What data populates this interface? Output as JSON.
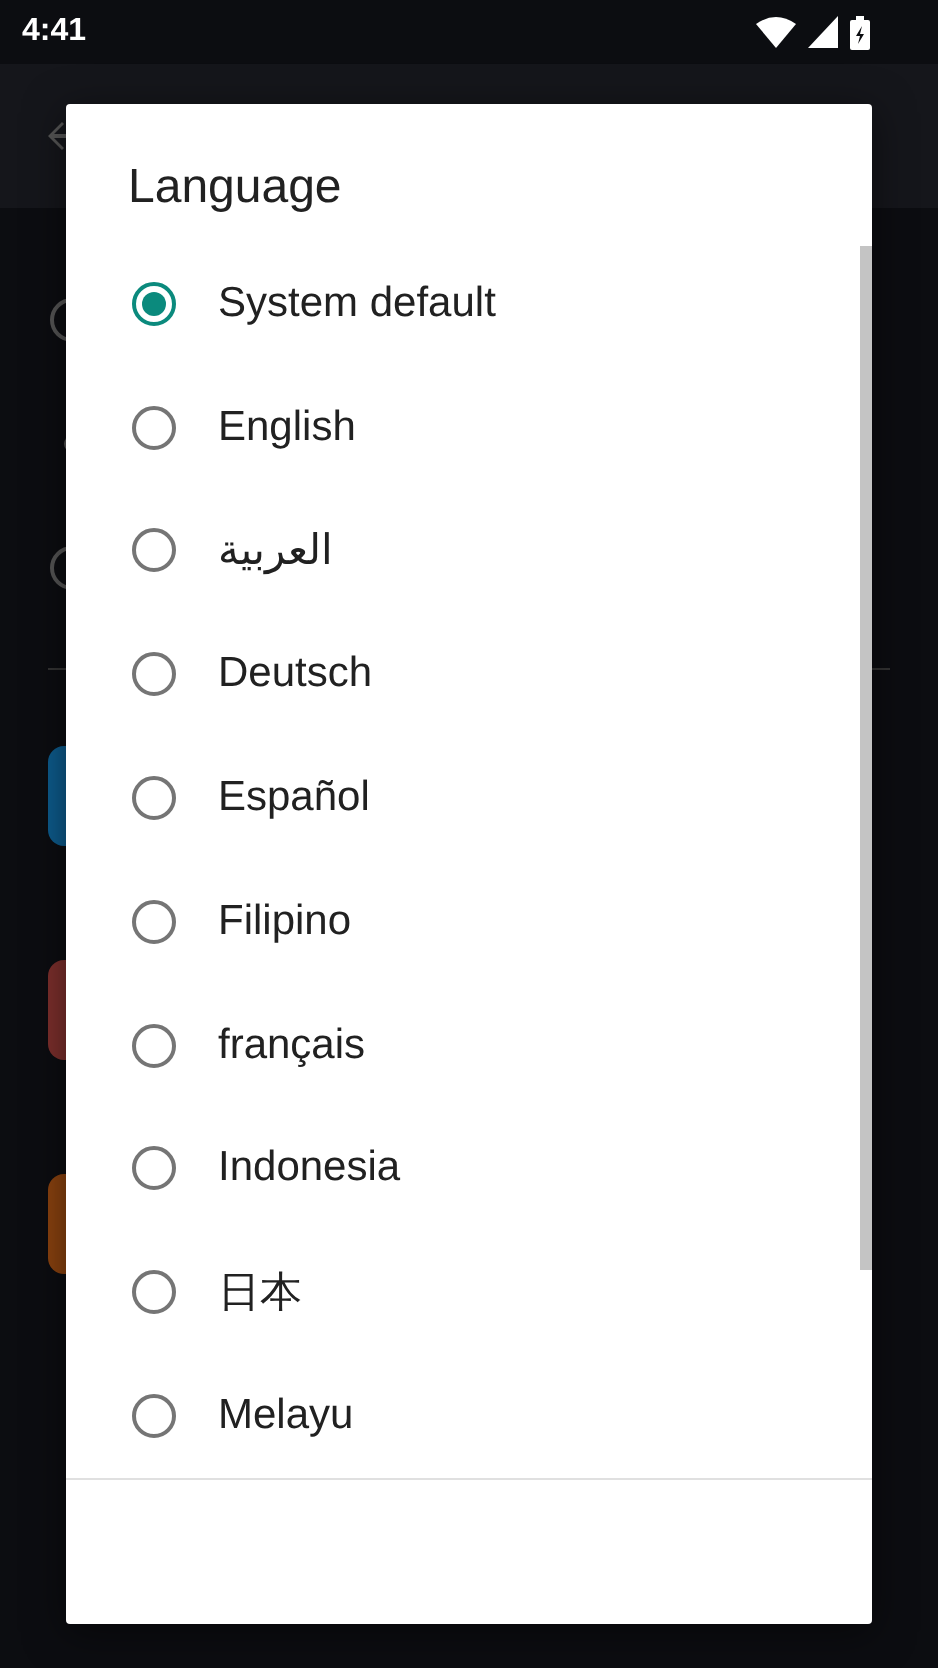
{
  "status_bar": {
    "time": "4:41"
  },
  "dialog": {
    "title": "Language",
    "options": [
      {
        "label": "System default",
        "selected": true
      },
      {
        "label": "English",
        "selected": false
      },
      {
        "label": "العربية",
        "selected": false
      },
      {
        "label": "Deutsch",
        "selected": false
      },
      {
        "label": "Español",
        "selected": false
      },
      {
        "label": "Filipino",
        "selected": false
      },
      {
        "label": "français",
        "selected": false
      },
      {
        "label": "Indonesia",
        "selected": false
      },
      {
        "label": "日本",
        "selected": false
      },
      {
        "label": "Melayu",
        "selected": false
      }
    ]
  }
}
